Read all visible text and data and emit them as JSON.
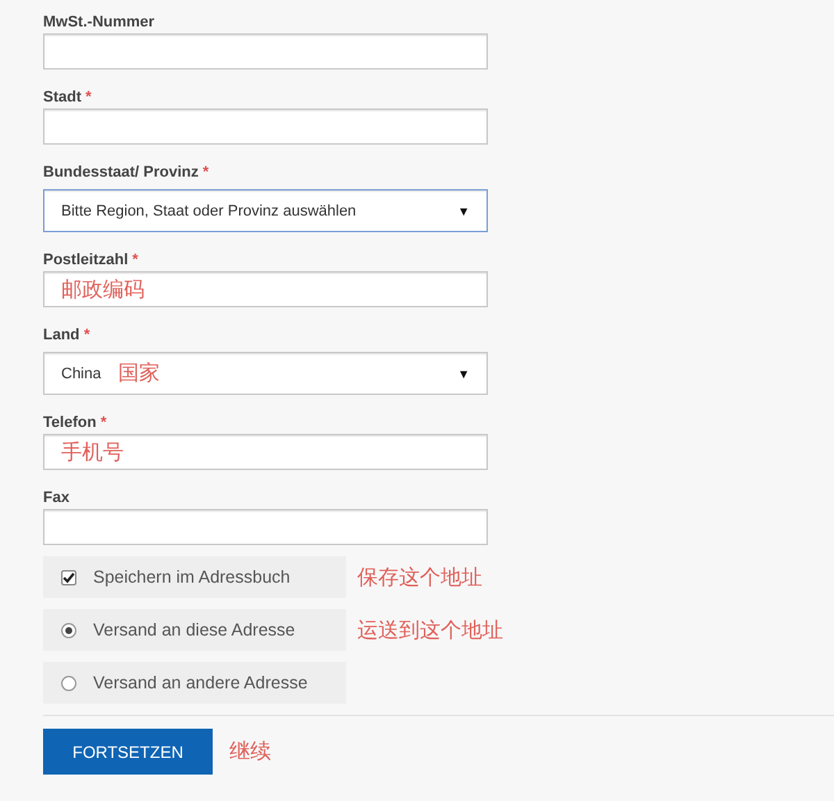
{
  "fields": [
    {
      "kind": "text",
      "label": "MwSt.-Nummer",
      "required": false
    },
    {
      "kind": "text",
      "label": "Stadt",
      "required": true
    },
    {
      "kind": "select",
      "label": "Bundesstaat/ Provinz",
      "required": true,
      "value": "Bitte Region, Staat oder Provinz auswählen",
      "focused": true,
      "arrow": "▼"
    },
    {
      "kind": "text",
      "label": "Postleitzahl",
      "required": true,
      "annotation": "邮政编码"
    },
    {
      "kind": "select",
      "label": "Land",
      "required": true,
      "value": "China",
      "annotation": "国家",
      "focused": false,
      "arrow": "▼"
    },
    {
      "kind": "text",
      "label": "Telefon",
      "required": true,
      "annotation": "手机号"
    },
    {
      "kind": "text",
      "label": "Fax",
      "required": false
    }
  ],
  "required_mark": "*",
  "options": [
    {
      "kind": "checkbox",
      "label": "Speichern im Adressbuch",
      "checked": true,
      "annotation": "保存这个地址"
    },
    {
      "kind": "radio",
      "label": "Versand an diese Adresse",
      "selected": true,
      "annotation": "运送到这个地址"
    },
    {
      "kind": "radio",
      "label": "Versand an andere Adresse",
      "selected": false
    }
  ],
  "submit": {
    "label": "FORTSETZEN",
    "annotation": "继续"
  }
}
